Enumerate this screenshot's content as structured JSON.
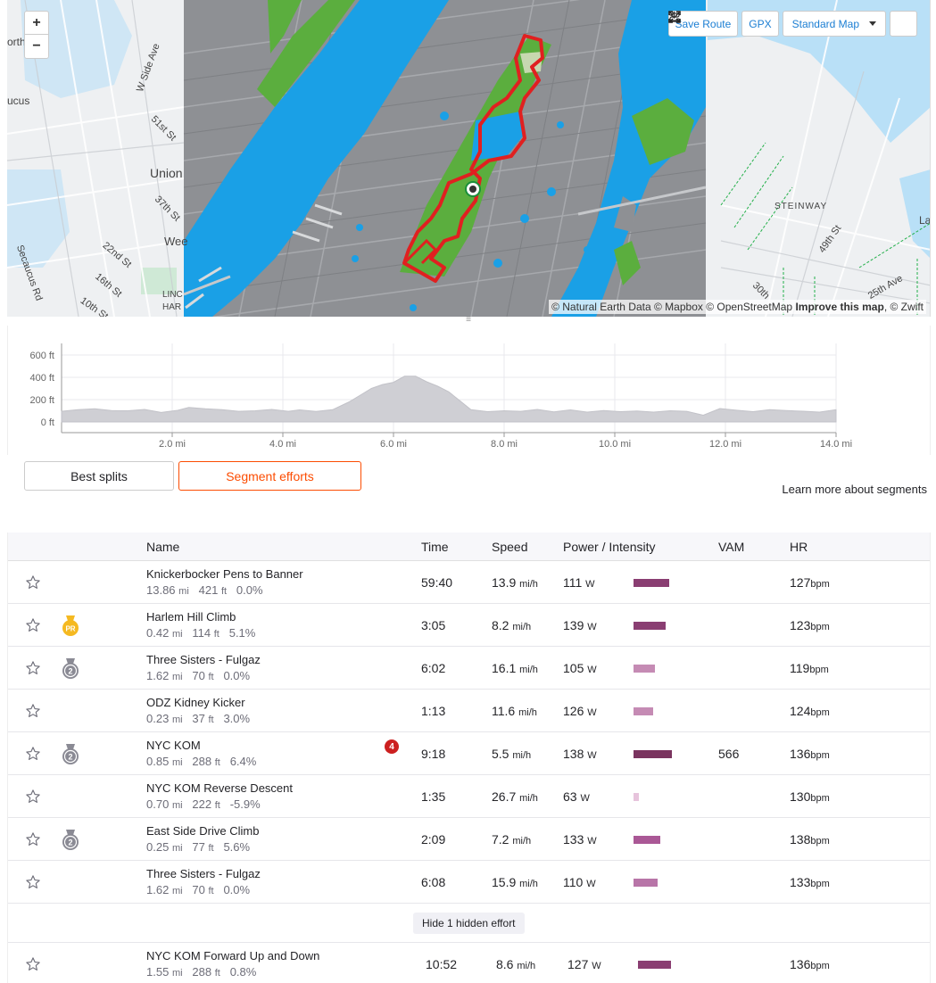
{
  "map": {
    "controls": {
      "zoom_in": "+",
      "zoom_out": "−",
      "save_route": "Save Route",
      "gpx": "GPX",
      "map_style": "Standard Map"
    },
    "attribution": {
      "natural_earth": "© Natural Earth Data",
      "mapbox": "© Mapbox",
      "osm": "© OpenStreetMap",
      "improve": "Improve this map",
      "zwift": "© Zwift"
    },
    "labels": {
      "secaucus": "ucus",
      "union": "Union",
      "weehawken": "Wee",
      "w_side_ave": "W Side Ave",
      "st51": "51st St",
      "st37": "37th St",
      "st22": "22nd St",
      "st16": "16th St",
      "st10": "10th St",
      "secaucus_rd": "Secaucus Rd",
      "linc": "LINC",
      "har": "HAR",
      "north": "orth",
      "steinway": "STEINWAY",
      "st49": "49th St",
      "av25": "25th Ave",
      "st30": "30th",
      "la": "La"
    }
  },
  "elevation": {
    "y_ticks": [
      "600 ft",
      "400 ft",
      "200 ft",
      "0 ft"
    ],
    "x_ticks": [
      "2.0 mi",
      "4.0 mi",
      "6.0 mi",
      "8.0 mi",
      "10.0 mi",
      "12.0 mi",
      "14.0 mi"
    ],
    "profile": [
      [
        0,
        95
      ],
      [
        0.3,
        110
      ],
      [
        0.6,
        118
      ],
      [
        0.9,
        102
      ],
      [
        1.2,
        100
      ],
      [
        1.5,
        112
      ],
      [
        1.8,
        85
      ],
      [
        2.1,
        104
      ],
      [
        2.3,
        130
      ],
      [
        2.6,
        118
      ],
      [
        2.9,
        110
      ],
      [
        3.2,
        95
      ],
      [
        3.5,
        100
      ],
      [
        3.8,
        112
      ],
      [
        4.1,
        95
      ],
      [
        4.3,
        108
      ],
      [
        4.6,
        94
      ],
      [
        4.9,
        110
      ],
      [
        5.2,
        180
      ],
      [
        5.4,
        240
      ],
      [
        5.6,
        300
      ],
      [
        5.8,
        335
      ],
      [
        6.0,
        355
      ],
      [
        6.2,
        410
      ],
      [
        6.4,
        410
      ],
      [
        6.6,
        360
      ],
      [
        6.8,
        320
      ],
      [
        7.0,
        270
      ],
      [
        7.2,
        190
      ],
      [
        7.4,
        110
      ],
      [
        7.7,
        92
      ],
      [
        8.0,
        100
      ],
      [
        8.3,
        95
      ],
      [
        8.6,
        112
      ],
      [
        8.9,
        90
      ],
      [
        9.2,
        108
      ],
      [
        9.5,
        88
      ],
      [
        9.8,
        102
      ],
      [
        10.1,
        92
      ],
      [
        10.4,
        98
      ],
      [
        10.7,
        88
      ],
      [
        11.0,
        100
      ],
      [
        11.3,
        95
      ],
      [
        11.6,
        60
      ],
      [
        11.9,
        120
      ],
      [
        12.2,
        105
      ],
      [
        12.5,
        92
      ],
      [
        12.8,
        110
      ],
      [
        13.1,
        102
      ],
      [
        13.4,
        96
      ],
      [
        13.7,
        88
      ],
      [
        14.0,
        110
      ]
    ]
  },
  "tabs": {
    "best_splits": "Best splits",
    "segment_efforts": "Segment efforts"
  },
  "learn_more": "Learn more about segments",
  "table": {
    "headers": {
      "name": "Name",
      "time": "Time",
      "speed": "Speed",
      "power": "Power / Intensity",
      "vam": "VAM",
      "hr": "HR"
    },
    "units": {
      "mi": "mi",
      "ft": "ft",
      "mih": "mi/h",
      "w": "W",
      "bpm": "bpm"
    },
    "rows": [
      {
        "name": "Knickerbocker Pens to Banner",
        "dist": "13.86",
        "elev": "421",
        "grade": "0.0%",
        "time": "59:40",
        "speed": "13.9",
        "power": "111",
        "intensity": 0.55,
        "bar_color": "#8a3e72",
        "vam": "",
        "hr": "127",
        "medal": ""
      },
      {
        "name": "Harlem Hill Climb",
        "dist": "0.42",
        "elev": "114",
        "grade": "5.1%",
        "time": "3:05",
        "speed": "8.2",
        "power": "139",
        "intensity": 0.5,
        "bar_color": "#8a3e72",
        "vam": "",
        "hr": "123",
        "medal": "pr"
      },
      {
        "name": "Three Sisters - Fulgaz",
        "dist": "1.62",
        "elev": "70",
        "grade": "0.0%",
        "time": "6:02",
        "speed": "16.1",
        "power": "105",
        "intensity": 0.33,
        "bar_color": "#c58bb4",
        "vam": "",
        "hr": "119",
        "medal": "2"
      },
      {
        "name": "ODZ Kidney Kicker",
        "dist": "0.23",
        "elev": "37",
        "grade": "3.0%",
        "time": "1:13",
        "speed": "11.6",
        "power": "126",
        "intensity": 0.3,
        "bar_color": "#c58bb4",
        "vam": "",
        "hr": "124",
        "medal": ""
      },
      {
        "name": "NYC KOM",
        "dist": "0.85",
        "elev": "288",
        "grade": "6.4%",
        "time": "9:18",
        "speed": "5.5",
        "power": "138",
        "intensity": 0.6,
        "bar_color": "#7a345f",
        "vam": "566",
        "hr": "136",
        "medal": "2",
        "badge": "4"
      },
      {
        "name": "NYC KOM Reverse Descent",
        "dist": "0.70",
        "elev": "222",
        "grade": "-5.9%",
        "time": "1:35",
        "speed": "26.7",
        "power": "63",
        "intensity": 0.08,
        "bar_color": "#e7c4dc",
        "vam": "",
        "hr": "130",
        "medal": ""
      },
      {
        "name": "East Side Drive Climb",
        "dist": "0.25",
        "elev": "77",
        "grade": "5.6%",
        "time": "2:09",
        "speed": "7.2",
        "power": "133",
        "intensity": 0.42,
        "bar_color": "#aa5896",
        "vam": "",
        "hr": "138",
        "medal": "2"
      },
      {
        "name": "Three Sisters - Fulgaz",
        "dist": "1.62",
        "elev": "70",
        "grade": "0.0%",
        "time": "6:08",
        "speed": "15.9",
        "power": "110",
        "intensity": 0.37,
        "bar_color": "#b875a8",
        "vam": "",
        "hr": "133",
        "medal": ""
      }
    ],
    "hide_hidden": "Hide 1 hidden effort",
    "hidden_rows": [
      {
        "name": "NYC KOM Forward Up and Down",
        "dist": "1.55",
        "elev": "288",
        "grade": "0.8%",
        "time": "10:52",
        "speed": "8.6",
        "power": "127",
        "intensity": 0.52,
        "bar_color": "#8a3e72",
        "vam": "",
        "hr": "136",
        "medal": ""
      }
    ]
  }
}
